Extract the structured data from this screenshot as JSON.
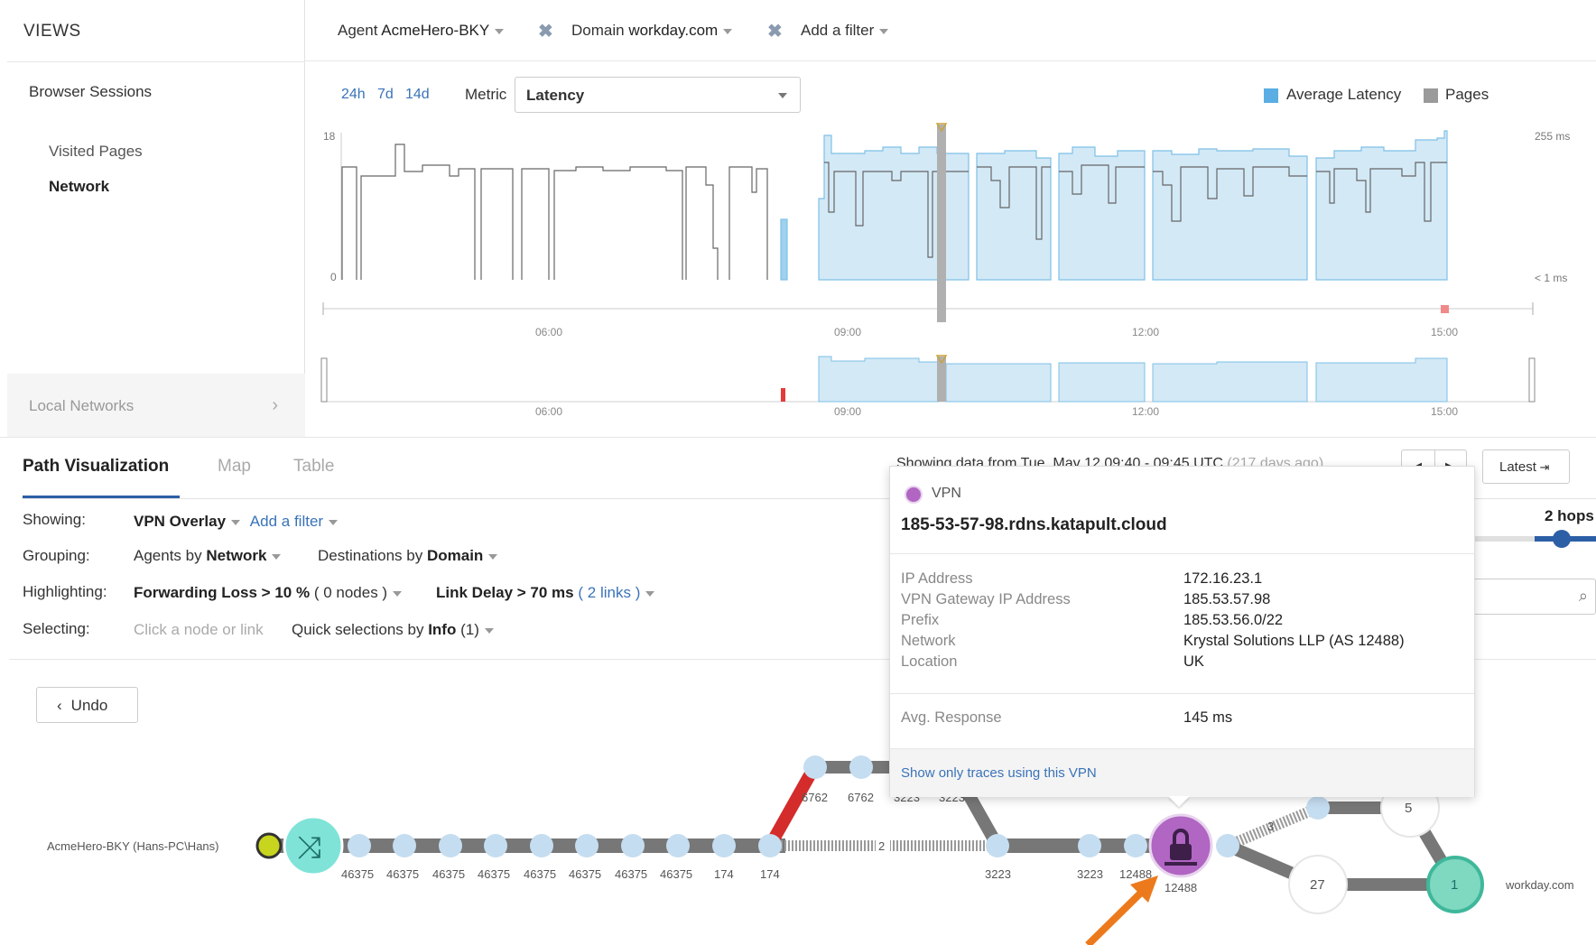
{
  "sidebar": {
    "title": "VIEWS",
    "section": "Browser Sessions",
    "items": [
      "Visited Pages",
      "Network"
    ],
    "active_item": "Network",
    "local_networks": "Local Networks"
  },
  "filters": {
    "agent_label": "Agent",
    "agent_value": "AcmeHero-BKY",
    "domain_label": "Domain",
    "domain_value": "workday.com",
    "add_filter": "Add a filter"
  },
  "chart_controls": {
    "ranges": [
      "24h",
      "7d",
      "14d"
    ],
    "metric_label": "Metric",
    "metric_value": "Latency",
    "legend": [
      {
        "label": "Average Latency",
        "color": "#5aaee3"
      },
      {
        "label": "Pages",
        "color": "#9a9a9a"
      }
    ]
  },
  "chart_data": {
    "type": "area",
    "y_left_max_label": "18",
    "y_left_min_label": "0",
    "y_right_max_label": "255 ms",
    "y_right_min_label": "< 1 ms",
    "x_ticks": [
      "06:00",
      "09:00",
      "12:00",
      "15:00"
    ]
  },
  "tabs": {
    "items": [
      "Path Visualization",
      "Map",
      "Table"
    ],
    "active": "Path Visualization"
  },
  "options": {
    "showing_label": "Showing:",
    "showing_value": "VPN Overlay",
    "showing_add": "Add a filter",
    "grouping_label": "Grouping:",
    "grouping_agents_prefix": "Agents by",
    "grouping_agents_value": "Network",
    "grouping_dest_prefix": "Destinations by",
    "grouping_dest_value": "Domain",
    "highlighting_label": "Highlighting:",
    "hl_loss": "Forwarding Loss > 10 %",
    "hl_loss_count": "( 0 nodes )",
    "hl_delay": "Link Delay > 70 ms",
    "hl_delay_open": "(",
    "hl_delay_count": "2 links",
    "hl_delay_close": ")",
    "selecting_label": "Selecting:",
    "selecting_hint": "Click a node or link",
    "quick_prefix": "Quick selections by",
    "quick_value": "Info",
    "quick_count": "(1)"
  },
  "toolbar": {
    "showing_data": "Showing data from Tue, May 12 09:40 - 09:45 UTC",
    "showing_data_ago": "(217 days ago)",
    "latest": "Latest",
    "hops": "2 hops",
    "undo": "Undo"
  },
  "tooltip": {
    "type": "VPN",
    "hostname": "185-53-57-98.rdns.katapult.cloud",
    "rows": [
      {
        "k": "IP Address",
        "v": "172.16.23.1"
      },
      {
        "k": "VPN Gateway IP Address",
        "v": "185.53.57.98"
      },
      {
        "k": "Prefix",
        "v": "185.53.56.0/22"
      },
      {
        "k": "Network",
        "v": "Krystal Solutions LLP (AS 12488)"
      },
      {
        "k": "Location",
        "v": "UK"
      }
    ],
    "avg_label": "Avg. Response",
    "avg_value": "145 ms",
    "footer_link": "Show only traces using this VPN"
  },
  "path": {
    "agent_label": "AcmeHero-BKY (Hans-PC\\Hans)",
    "destination_label": "workday.com",
    "hop_labels": [
      "46375",
      "46375",
      "46375",
      "46375",
      "46375",
      "46375",
      "46375",
      "46375",
      "174",
      "174",
      "3223",
      "3223",
      "12488",
      "12488"
    ],
    "upper_labels": [
      "6762",
      "6762",
      "3223",
      "3223"
    ],
    "link_count_main": "2",
    "link_count_branch": "3",
    "node_numbers": [
      "5",
      "27",
      "1"
    ]
  }
}
